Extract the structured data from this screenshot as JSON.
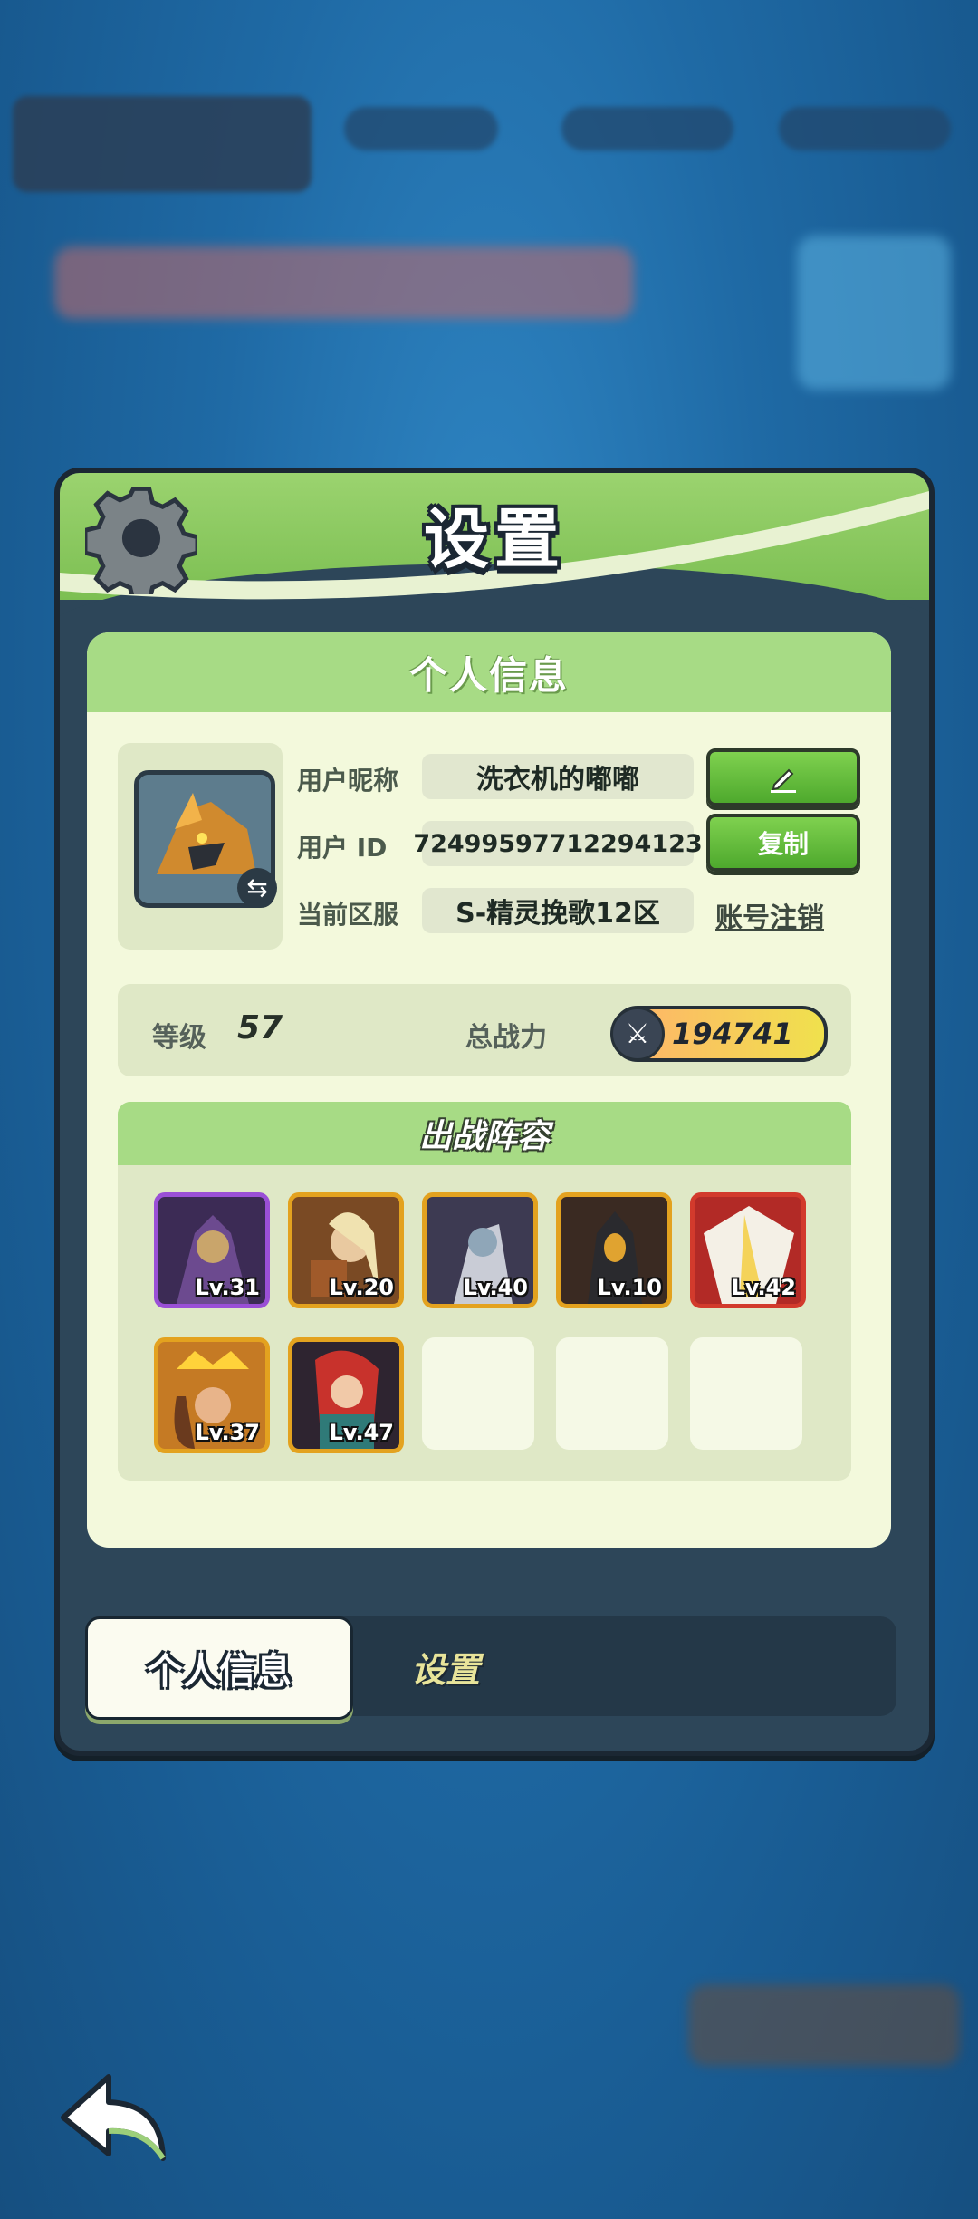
{
  "panel": {
    "title": "设置"
  },
  "card": {
    "header": "个人信息",
    "labels": {
      "nickname": "用户昵称",
      "user_id": "用户 ID",
      "server": "当前区服"
    },
    "values": {
      "nickname": "洗衣机的嘟嘟",
      "user_id": "72499597712294123",
      "server": "S-精灵挽歌12区"
    },
    "buttons": {
      "copy": "复制",
      "cancel_account": "账号注销"
    },
    "icons": {
      "edit": "pencil-icon",
      "swap_avatar": "swap-icon"
    }
  },
  "stats": {
    "level_label": "等级",
    "level": "57",
    "power_label": "总战力",
    "power": "194741"
  },
  "team": {
    "header": "出战阵容",
    "heroes": [
      {
        "level": "Lv.31",
        "frame": "#9a4fd6"
      },
      {
        "level": "Lv.20",
        "frame": "#e3a21f"
      },
      {
        "level": "Lv.40",
        "frame": "#e3a21f"
      },
      {
        "level": "Lv.10",
        "frame": "#e3a21f"
      },
      {
        "level": "Lv.42",
        "frame": "#d23a2c"
      },
      {
        "level": "Lv.37",
        "frame": "#e3a21f"
      },
      {
        "level": "Lv.47",
        "frame": "#e3a21f"
      }
    ],
    "empty_slots": 3
  },
  "tabs": {
    "active": "个人信息",
    "inactive": "设置"
  },
  "colors": {
    "accent_green": "#7cbf52",
    "panel_dark": "#2d4659",
    "card_bg": "#f3f9dc"
  }
}
